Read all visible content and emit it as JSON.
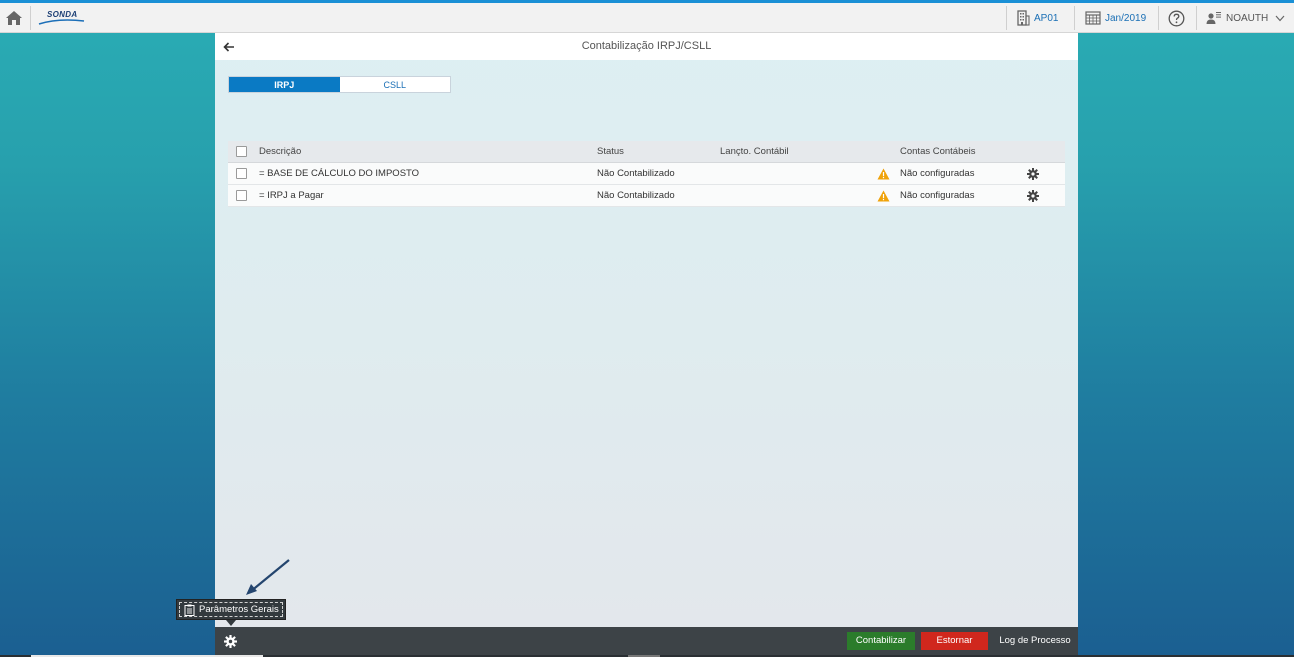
{
  "shell": {
    "logo_text": "SONDA",
    "company": "AP01",
    "period": "Jan/2019",
    "user": "NOAUTH"
  },
  "panel": {
    "title": "Contabilização IRPJ/CSLL",
    "tabs": [
      {
        "label": "IRPJ",
        "active": true
      },
      {
        "label": "CSLL",
        "active": false
      }
    ]
  },
  "table": {
    "headers": {
      "descricao": "Descrição",
      "status": "Status",
      "lancamento": "Lançto. Contábil",
      "contas": "Contas Contábeis"
    },
    "rows": [
      {
        "descricao": "= BASE DE CÁLCULO DO IMPOSTO",
        "status": "Não Contabilizado",
        "lancamento": "",
        "contas": "Não configuradas"
      },
      {
        "descricao": "= IRPJ a Pagar",
        "status": "Não Contabilizado",
        "lancamento": "",
        "contas": "Não configuradas"
      }
    ]
  },
  "footer": {
    "contabilizar": "Contabilizar",
    "estornar": "Estornar",
    "log": "Log de Processo",
    "tooltip": "Parâmetros Gerais"
  },
  "colors": {
    "accent": "#0a7ac4",
    "shell_top": "#1a90d6",
    "warning": "#f0a30a",
    "success_button": "#2b7c2b",
    "danger_button": "#d0271d"
  }
}
